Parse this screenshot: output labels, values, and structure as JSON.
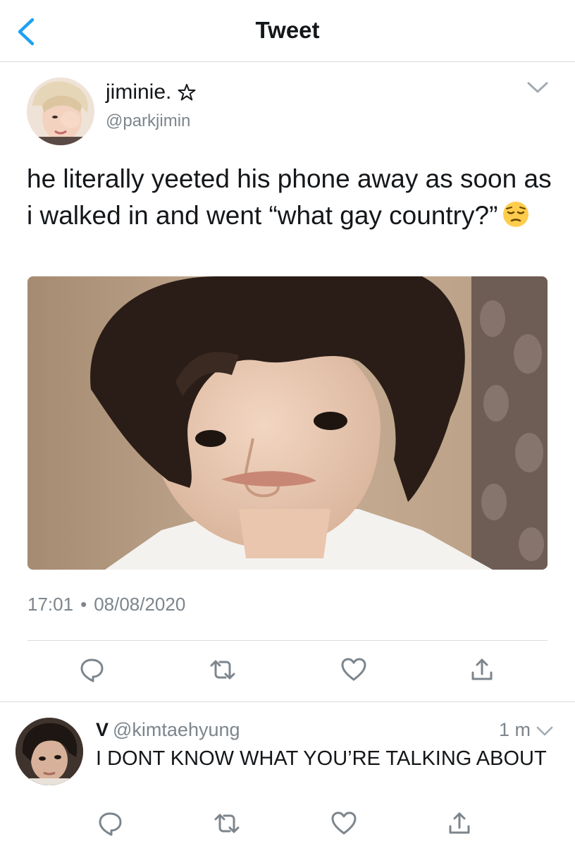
{
  "header": {
    "title": "Tweet",
    "back_icon": "chevron-left-icon",
    "accent_color": "#1da1f2"
  },
  "tweet": {
    "display_name": "jiminie.",
    "name_badge_icon": "star-outline-icon",
    "handle": "@parkjimin",
    "text": "he literally yeeted his phone away as soon as i walked in and went “what gay country?”",
    "emoji": "pensive-face-emoji",
    "timestamp_time": "17:01",
    "timestamp_separator": "•",
    "timestamp_date": "08/08/2020",
    "actions": [
      "reply-icon",
      "retweet-icon",
      "like-icon",
      "share-icon"
    ]
  },
  "reply": {
    "display_name": "V",
    "handle": "@kimtaehyung",
    "time": "1 m",
    "text": "I DONT KNOW WHAT YOU’RE TALKING ABOUT",
    "actions": [
      "reply-icon",
      "retweet-icon",
      "like-icon",
      "share-icon"
    ]
  },
  "colors": {
    "text_primary": "#14171a",
    "text_secondary": "#7d858c",
    "divider": "#d9dde0",
    "icon_gray": "#7d858c"
  }
}
